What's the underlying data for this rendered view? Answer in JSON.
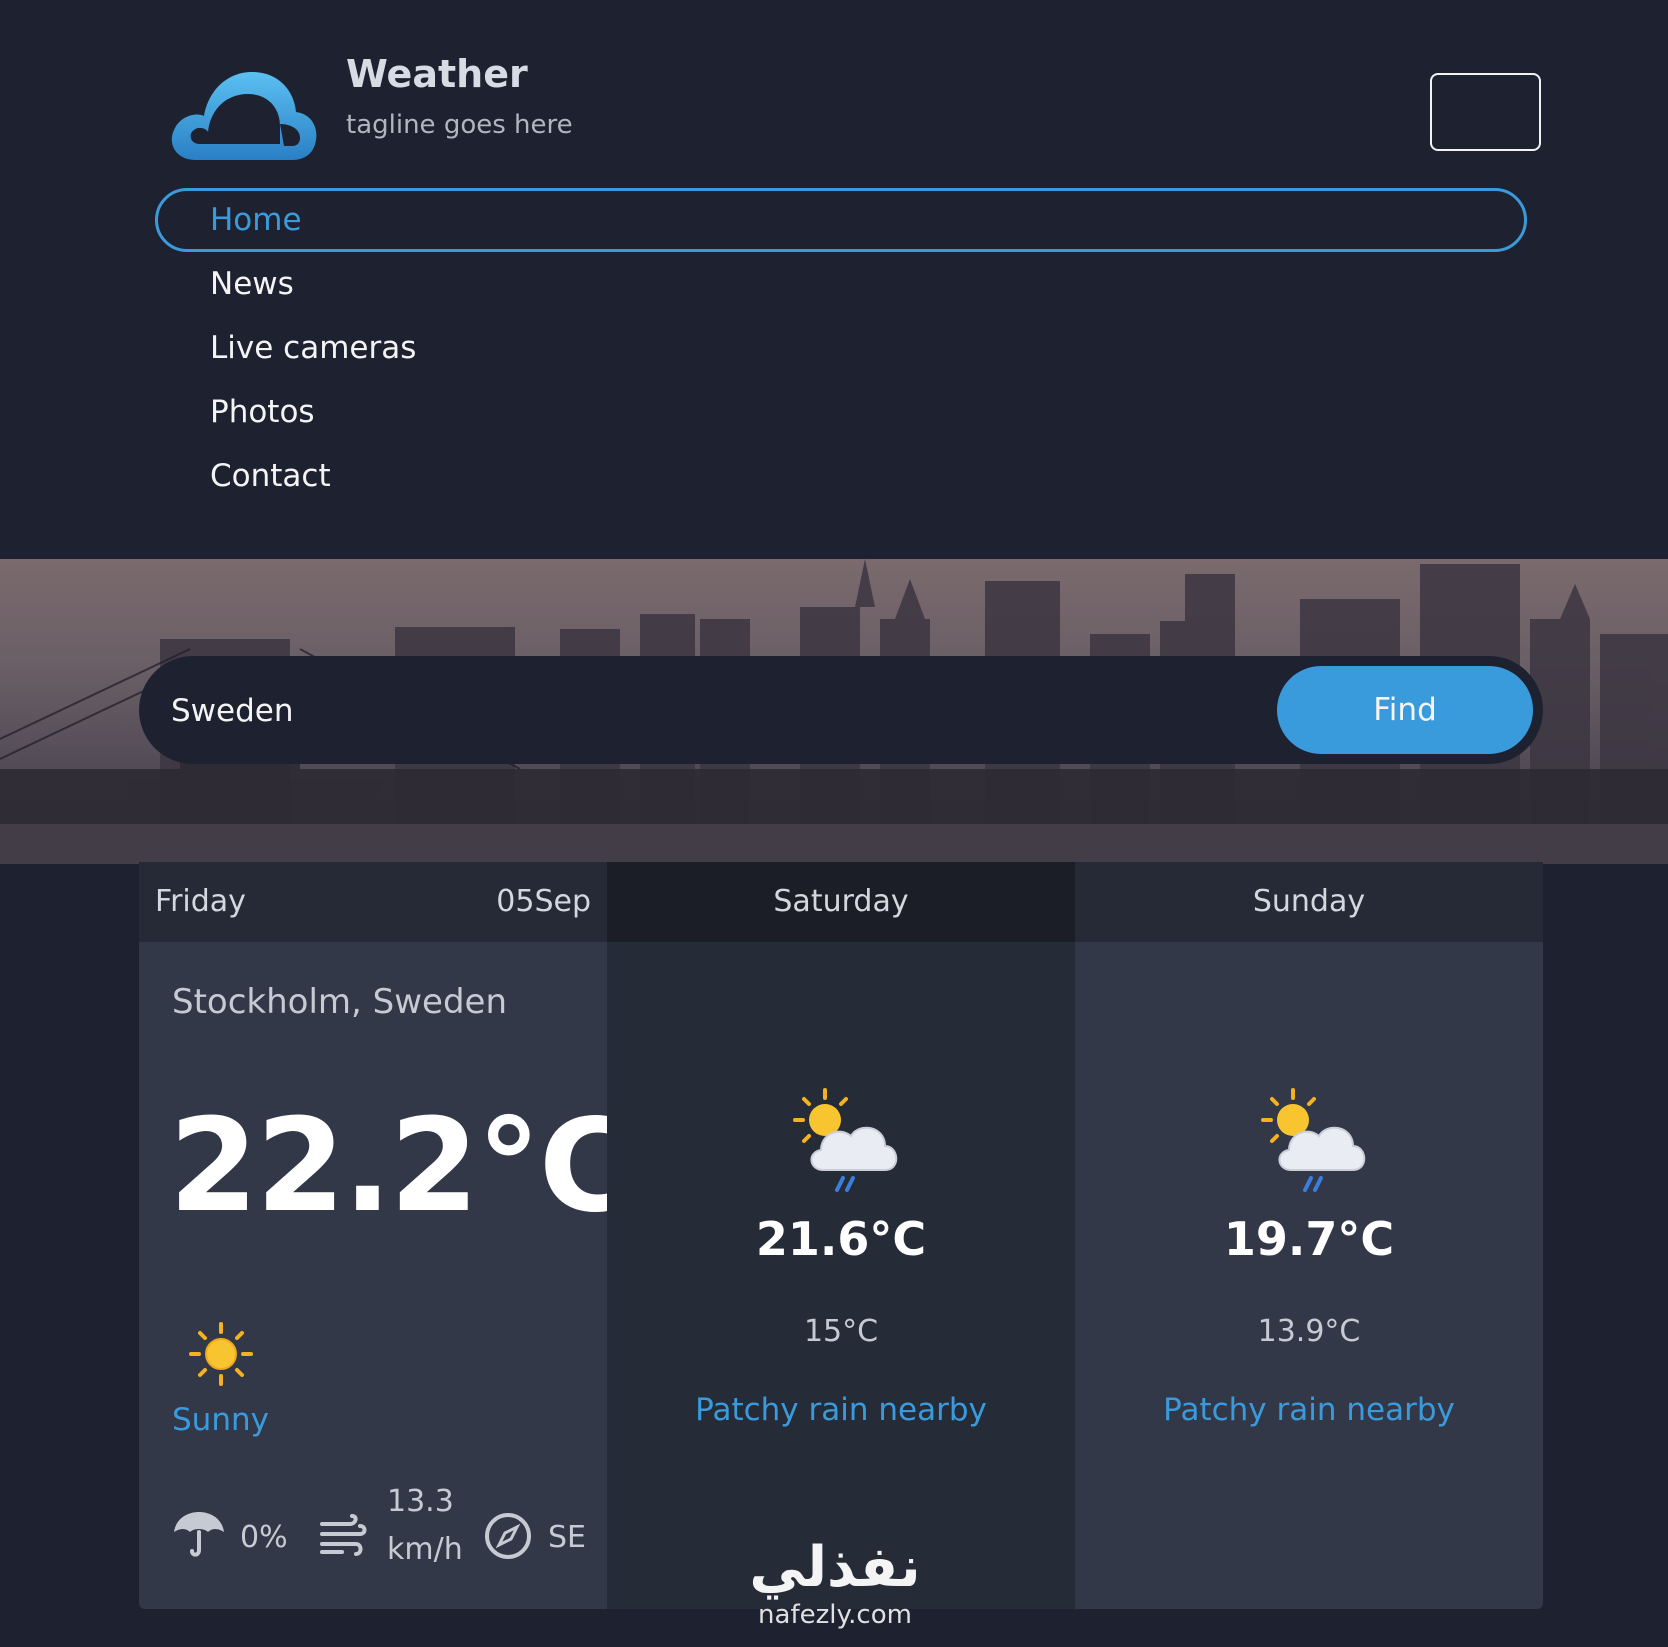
{
  "brand": {
    "title": "Weather",
    "tagline": "tagline goes here",
    "logo_icon": "cloud-icon"
  },
  "menu_toggle_icon": "hamburger-icon",
  "nav": {
    "items": [
      {
        "label": "Home",
        "active": true
      },
      {
        "label": "News",
        "active": false
      },
      {
        "label": "Live cameras",
        "active": false
      },
      {
        "label": "Photos",
        "active": false
      },
      {
        "label": "Contact",
        "active": false
      }
    ]
  },
  "search": {
    "value": "Sweden",
    "button_label": "Find"
  },
  "colors": {
    "background": "#1e2230",
    "accent": "#3a9bdc",
    "panel": "#323847",
    "panel_alt": "#262b38"
  },
  "forecast": {
    "today": {
      "day": "Friday",
      "date": "05Sep",
      "location": "Stockholm, Sweden",
      "temperature": "22.2°C",
      "condition": "Sunny",
      "condition_icon": "sun-icon",
      "rain_chance": "0%",
      "wind_speed_value": "13.3",
      "wind_speed_unit": "km/h",
      "wind_direction": "SE"
    },
    "days": [
      {
        "day": "Saturday",
        "max": "21.6°C",
        "min": "15°C",
        "condition": "Patchy rain nearby",
        "icon": "sun-cloud-rain-icon"
      },
      {
        "day": "Sunday",
        "max": "19.7°C",
        "min": "13.9°C",
        "condition": "Patchy rain nearby",
        "icon": "sun-cloud-rain-icon"
      }
    ]
  },
  "watermark": {
    "arabic": "نفذلي",
    "latin": "nafezly.com"
  }
}
